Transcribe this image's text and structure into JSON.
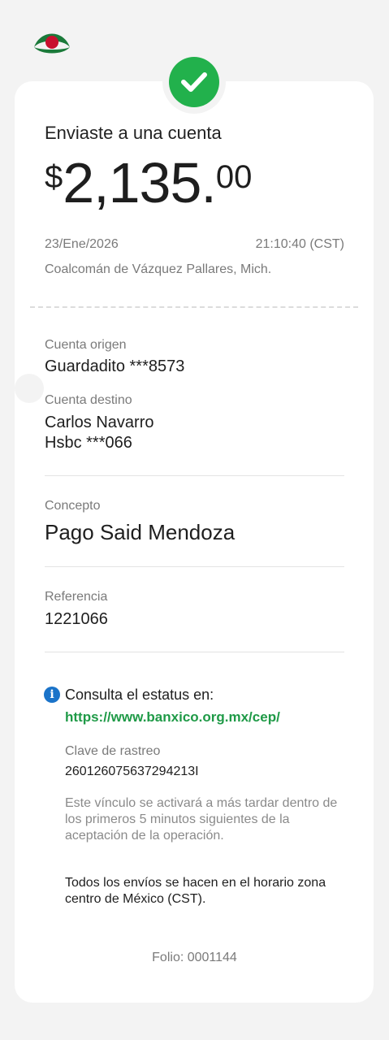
{
  "header": {
    "logo": "banco-logo-icon",
    "status_icon": "check-circle-icon"
  },
  "receipt": {
    "title": "Enviaste a una cuenta",
    "amount": {
      "currency": "$",
      "whole": "2,135.",
      "cents": "00"
    },
    "date": "23/Ene/2026",
    "time": "21:10:40 (CST)",
    "location": "Coalcomán de Vázquez Pallares, Mich."
  },
  "accounts": {
    "origin_label": "Cuenta origen",
    "origin_value": "Guardadito ***8573",
    "dest_label": "Cuenta destino",
    "dest_name": "Carlos Navarro",
    "dest_account": "Hsbc ***066"
  },
  "concept": {
    "label": "Concepto",
    "value": "Pago Said Mendoza"
  },
  "reference": {
    "label": "Referencia",
    "value": "1221066"
  },
  "status": {
    "icon": "info-icon",
    "text": "Consulta el estatus en:",
    "link": "https://www.banxico.org.mx/cep/",
    "tracking_label": "Clave de rastreo",
    "tracking_value": "2601260756372942​13I",
    "activation_note": "Este vínculo se activará a más tardar dentro de los primeros 5 minutos siguientes de la aceptación de la operación.",
    "timezone_note": "Todos los envíos se hacen en el horario zona centro de México (CST)."
  },
  "folio": "Folio: 0001144",
  "colors": {
    "accent_green": "#22b14c",
    "link_green": "#1f9a47",
    "info_blue": "#1a73c9",
    "logo_red": "#c8102e"
  }
}
